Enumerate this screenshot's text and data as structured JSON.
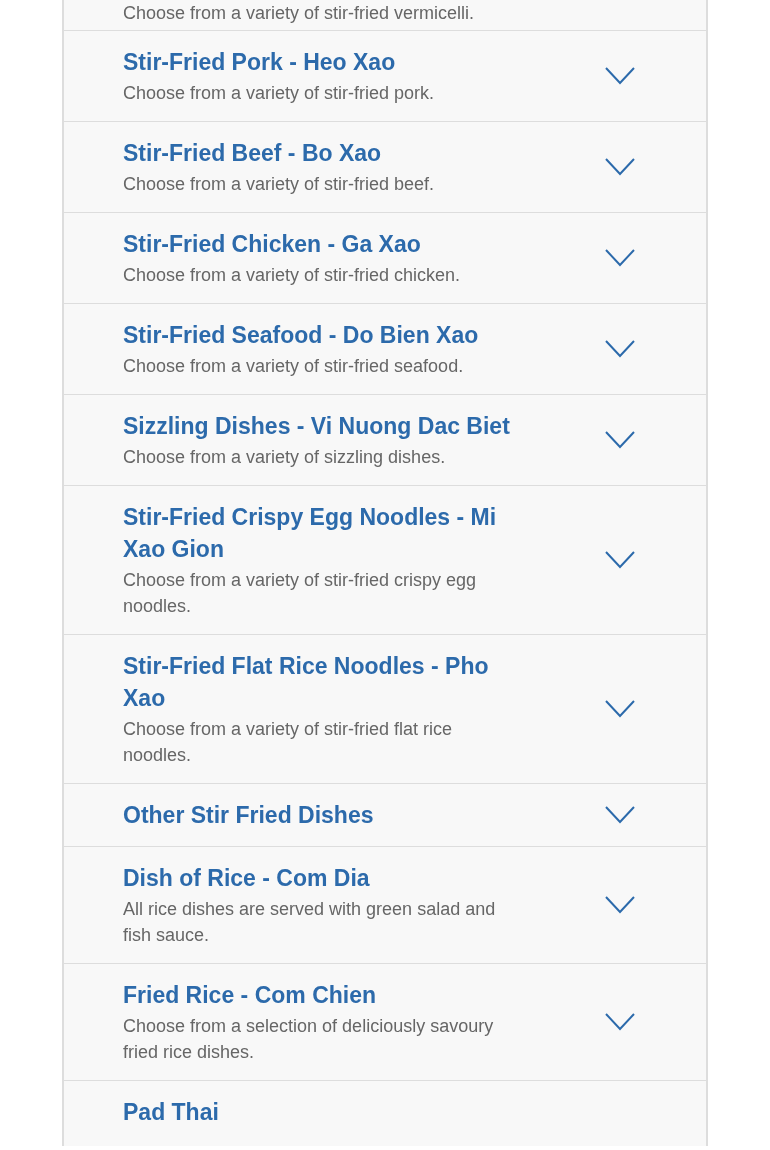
{
  "partial_top_item": {
    "description": "Choose from a variety of stir-fried vermicelli."
  },
  "categories": [
    {
      "title": "Stir-Fried Pork - Heo Xao",
      "description": "Choose from a variety of stir-fried pork."
    },
    {
      "title": "Stir-Fried Beef - Bo Xao",
      "description": "Choose from a variety of stir-fried beef."
    },
    {
      "title": "Stir-Fried Chicken - Ga Xao",
      "description": "Choose from a variety of stir-fried chicken."
    },
    {
      "title": "Stir-Fried Seafood - Do Bien Xao",
      "description": "Choose from a variety of stir-fried seafood."
    },
    {
      "title": "Sizzling Dishes - Vi Nuong Dac Biet",
      "description": "Choose from a variety of sizzling dishes."
    },
    {
      "title": "Stir-Fried Crispy Egg Noodles - Mi Xao Gion",
      "description": "Choose from a variety of stir-fried crispy egg noodles."
    },
    {
      "title": "Stir-Fried Flat Rice Noodles - Pho Xao",
      "description": "Choose from a variety of stir-fried flat rice noodles."
    },
    {
      "title": "Other Stir Fried Dishes"
    },
    {
      "title": "Dish of Rice - Com Dia",
      "description": "All rice dishes are served with green salad and fish sauce."
    },
    {
      "title": "Fried Rice - Com Chien",
      "description": "Choose from a selection of deliciously savoury fried rice dishes."
    }
  ],
  "partial_bottom_item": {
    "title": "Pad Thai"
  }
}
